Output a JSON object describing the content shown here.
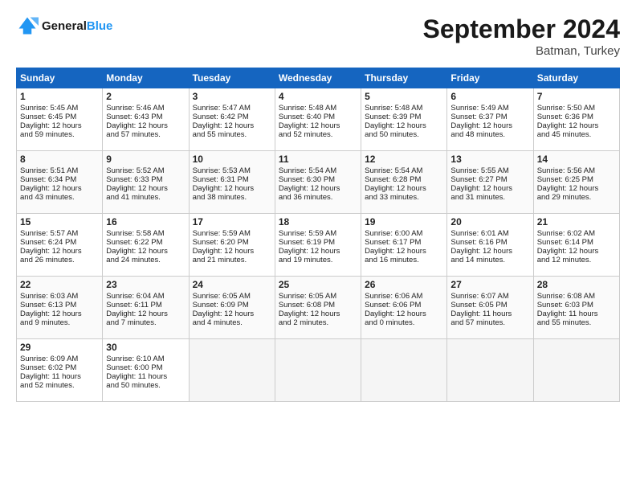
{
  "header": {
    "logo_line1": "General",
    "logo_line2": "Blue",
    "month_title": "September 2024",
    "location": "Batman, Turkey"
  },
  "weekdays": [
    "Sunday",
    "Monday",
    "Tuesday",
    "Wednesday",
    "Thursday",
    "Friday",
    "Saturday"
  ],
  "weeks": [
    [
      {
        "day": "1",
        "lines": [
          "Sunrise: 5:45 AM",
          "Sunset: 6:45 PM",
          "Daylight: 12 hours",
          "and 59 minutes."
        ]
      },
      {
        "day": "2",
        "lines": [
          "Sunrise: 5:46 AM",
          "Sunset: 6:43 PM",
          "Daylight: 12 hours",
          "and 57 minutes."
        ]
      },
      {
        "day": "3",
        "lines": [
          "Sunrise: 5:47 AM",
          "Sunset: 6:42 PM",
          "Daylight: 12 hours",
          "and 55 minutes."
        ]
      },
      {
        "day": "4",
        "lines": [
          "Sunrise: 5:48 AM",
          "Sunset: 6:40 PM",
          "Daylight: 12 hours",
          "and 52 minutes."
        ]
      },
      {
        "day": "5",
        "lines": [
          "Sunrise: 5:48 AM",
          "Sunset: 6:39 PM",
          "Daylight: 12 hours",
          "and 50 minutes."
        ]
      },
      {
        "day": "6",
        "lines": [
          "Sunrise: 5:49 AM",
          "Sunset: 6:37 PM",
          "Daylight: 12 hours",
          "and 48 minutes."
        ]
      },
      {
        "day": "7",
        "lines": [
          "Sunrise: 5:50 AM",
          "Sunset: 6:36 PM",
          "Daylight: 12 hours",
          "and 45 minutes."
        ]
      }
    ],
    [
      {
        "day": "8",
        "lines": [
          "Sunrise: 5:51 AM",
          "Sunset: 6:34 PM",
          "Daylight: 12 hours",
          "and 43 minutes."
        ]
      },
      {
        "day": "9",
        "lines": [
          "Sunrise: 5:52 AM",
          "Sunset: 6:33 PM",
          "Daylight: 12 hours",
          "and 41 minutes."
        ]
      },
      {
        "day": "10",
        "lines": [
          "Sunrise: 5:53 AM",
          "Sunset: 6:31 PM",
          "Daylight: 12 hours",
          "and 38 minutes."
        ]
      },
      {
        "day": "11",
        "lines": [
          "Sunrise: 5:54 AM",
          "Sunset: 6:30 PM",
          "Daylight: 12 hours",
          "and 36 minutes."
        ]
      },
      {
        "day": "12",
        "lines": [
          "Sunrise: 5:54 AM",
          "Sunset: 6:28 PM",
          "Daylight: 12 hours",
          "and 33 minutes."
        ]
      },
      {
        "day": "13",
        "lines": [
          "Sunrise: 5:55 AM",
          "Sunset: 6:27 PM",
          "Daylight: 12 hours",
          "and 31 minutes."
        ]
      },
      {
        "day": "14",
        "lines": [
          "Sunrise: 5:56 AM",
          "Sunset: 6:25 PM",
          "Daylight: 12 hours",
          "and 29 minutes."
        ]
      }
    ],
    [
      {
        "day": "15",
        "lines": [
          "Sunrise: 5:57 AM",
          "Sunset: 6:24 PM",
          "Daylight: 12 hours",
          "and 26 minutes."
        ]
      },
      {
        "day": "16",
        "lines": [
          "Sunrise: 5:58 AM",
          "Sunset: 6:22 PM",
          "Daylight: 12 hours",
          "and 24 minutes."
        ]
      },
      {
        "day": "17",
        "lines": [
          "Sunrise: 5:59 AM",
          "Sunset: 6:20 PM",
          "Daylight: 12 hours",
          "and 21 minutes."
        ]
      },
      {
        "day": "18",
        "lines": [
          "Sunrise: 5:59 AM",
          "Sunset: 6:19 PM",
          "Daylight: 12 hours",
          "and 19 minutes."
        ]
      },
      {
        "day": "19",
        "lines": [
          "Sunrise: 6:00 AM",
          "Sunset: 6:17 PM",
          "Daylight: 12 hours",
          "and 16 minutes."
        ]
      },
      {
        "day": "20",
        "lines": [
          "Sunrise: 6:01 AM",
          "Sunset: 6:16 PM",
          "Daylight: 12 hours",
          "and 14 minutes."
        ]
      },
      {
        "day": "21",
        "lines": [
          "Sunrise: 6:02 AM",
          "Sunset: 6:14 PM",
          "Daylight: 12 hours",
          "and 12 minutes."
        ]
      }
    ],
    [
      {
        "day": "22",
        "lines": [
          "Sunrise: 6:03 AM",
          "Sunset: 6:13 PM",
          "Daylight: 12 hours",
          "and 9 minutes."
        ]
      },
      {
        "day": "23",
        "lines": [
          "Sunrise: 6:04 AM",
          "Sunset: 6:11 PM",
          "Daylight: 12 hours",
          "and 7 minutes."
        ]
      },
      {
        "day": "24",
        "lines": [
          "Sunrise: 6:05 AM",
          "Sunset: 6:09 PM",
          "Daylight: 12 hours",
          "and 4 minutes."
        ]
      },
      {
        "day": "25",
        "lines": [
          "Sunrise: 6:05 AM",
          "Sunset: 6:08 PM",
          "Daylight: 12 hours",
          "and 2 minutes."
        ]
      },
      {
        "day": "26",
        "lines": [
          "Sunrise: 6:06 AM",
          "Sunset: 6:06 PM",
          "Daylight: 12 hours",
          "and 0 minutes."
        ]
      },
      {
        "day": "27",
        "lines": [
          "Sunrise: 6:07 AM",
          "Sunset: 6:05 PM",
          "Daylight: 11 hours",
          "and 57 minutes."
        ]
      },
      {
        "day": "28",
        "lines": [
          "Sunrise: 6:08 AM",
          "Sunset: 6:03 PM",
          "Daylight: 11 hours",
          "and 55 minutes."
        ]
      }
    ],
    [
      {
        "day": "29",
        "lines": [
          "Sunrise: 6:09 AM",
          "Sunset: 6:02 PM",
          "Daylight: 11 hours",
          "and 52 minutes."
        ]
      },
      {
        "day": "30",
        "lines": [
          "Sunrise: 6:10 AM",
          "Sunset: 6:00 PM",
          "Daylight: 11 hours",
          "and 50 minutes."
        ]
      },
      {
        "day": "",
        "lines": []
      },
      {
        "day": "",
        "lines": []
      },
      {
        "day": "",
        "lines": []
      },
      {
        "day": "",
        "lines": []
      },
      {
        "day": "",
        "lines": []
      }
    ]
  ]
}
